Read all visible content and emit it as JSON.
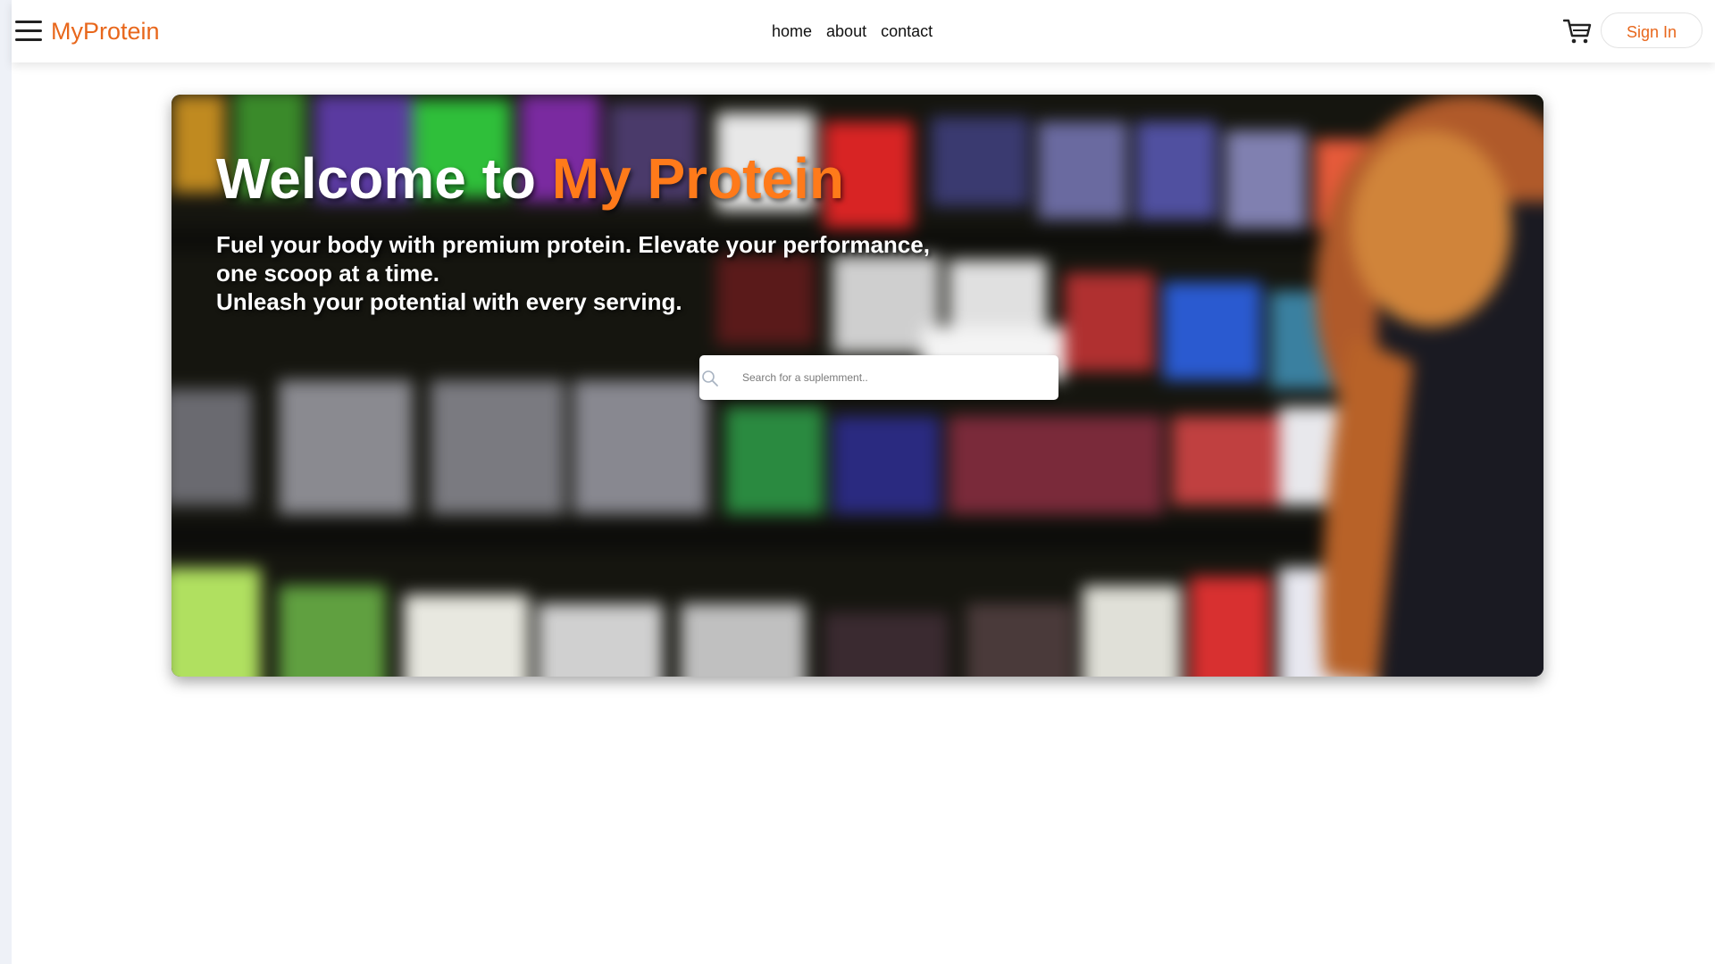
{
  "header": {
    "brand": "MyProtein",
    "menu_icon": "hamburger-menu-icon",
    "nav": [
      {
        "label": "home"
      },
      {
        "label": "about"
      },
      {
        "label": "contact"
      }
    ],
    "cart_icon": "shopping-cart-icon",
    "signin_label": "Sign In"
  },
  "hero": {
    "title_prefix": "Welcome to",
    "title_accent": "My Protein",
    "subtitle_line1": "Fuel your body with premium protein. Elevate your performance,",
    "subtitle_line2": "one scoop at a time.",
    "subtitle_line3": "Unleash your potential with every serving.",
    "background_image": "blurred supplement store shelves with protein tubs and a muscular man"
  },
  "search": {
    "icon": "search-icon",
    "placeholder": "Search for a suplemment..",
    "value": ""
  },
  "colors": {
    "brand": "#e8671c",
    "accent": "#ff7a1a",
    "text": "#111111",
    "background": "#ffffff"
  }
}
